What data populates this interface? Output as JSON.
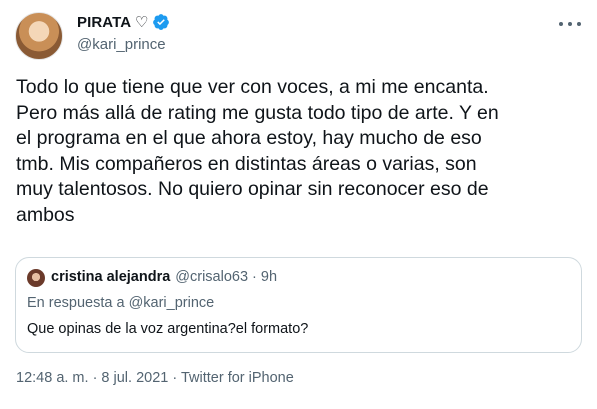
{
  "author": {
    "display_name": "PIRATA ♡",
    "handle": "@kari_prince",
    "verified": true,
    "avatar_icon": "profile-photo"
  },
  "tweet": {
    "text": "Todo lo que tiene que ver con voces, a mi me encanta.\nPero más allá de rating me gusta todo tipo de arte. Y en\nel programa en el que ahora estoy, hay mucho de eso\ntmb. Mis compañeros en distintas áreas o varias, son\nmuy talentosos. No quiero opinar sin reconocer eso de\nambos",
    "timestamp": "12:48 a. m. · 8 jul. 2021 · Twitter for iPhone"
  },
  "quoted_tweet": {
    "display_name": "cristina alejandra",
    "meta": "@crisalo63 · 9h",
    "reply_context": "En respuesta a @kari_prince",
    "text": "Que opinas de la voz argentina?el formato?"
  },
  "colors": {
    "text": "#0f1419",
    "secondary": "#536471",
    "verified": "#1d9bf0",
    "border": "#cfd9de"
  }
}
